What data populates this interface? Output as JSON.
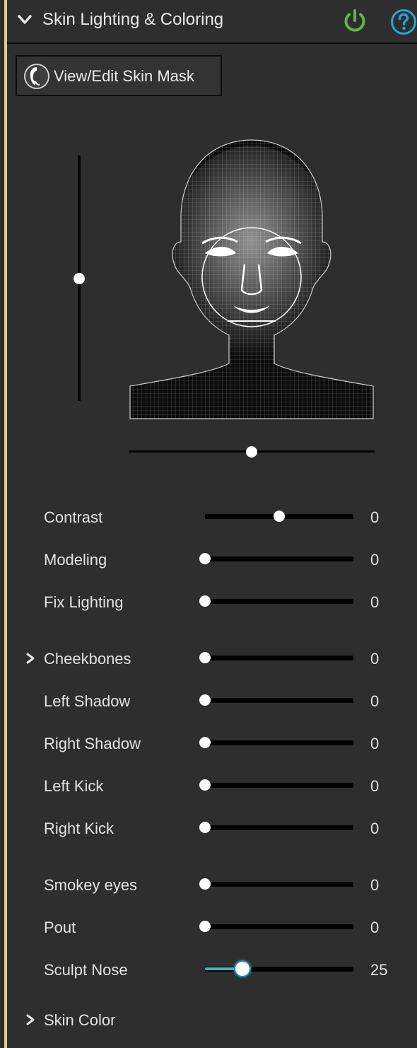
{
  "header": {
    "title": "Skin Lighting & Coloring",
    "power_color": "#5cb848",
    "help_color": "#29a3d6"
  },
  "mask_button": {
    "label": "View/Edit Skin Mask"
  },
  "light_direction": {
    "vertical_level": 0.5,
    "horizontal_level": 0.5
  },
  "sliders": [
    {
      "id": "contrast",
      "label": "Contrast",
      "value": "0",
      "level": 0.5,
      "has_chevron": false
    },
    {
      "id": "modeling",
      "label": "Modeling",
      "value": "0",
      "level": 0,
      "has_chevron": false
    },
    {
      "id": "fix-lighting",
      "label": "Fix Lighting",
      "value": "0",
      "level": 0,
      "has_chevron": false
    },
    {
      "id": "cheekbones",
      "label": "Cheekbones",
      "value": "0",
      "level": 0,
      "has_chevron": true
    },
    {
      "id": "left-shadow",
      "label": "Left Shadow",
      "value": "0",
      "level": 0,
      "has_chevron": false
    },
    {
      "id": "right-shadow",
      "label": "Right Shadow",
      "value": "0",
      "level": 0,
      "has_chevron": false
    },
    {
      "id": "left-kick",
      "label": "Left Kick",
      "value": "0",
      "level": 0,
      "has_chevron": false
    },
    {
      "id": "right-kick",
      "label": "Right Kick",
      "value": "0",
      "level": 0,
      "has_chevron": false
    },
    {
      "id": "smokey-eyes",
      "label": "Smokey eyes",
      "value": "0",
      "level": 0,
      "has_chevron": false
    },
    {
      "id": "pout",
      "label": "Pout",
      "value": "0",
      "level": 0,
      "has_chevron": false
    },
    {
      "id": "sculpt-nose",
      "label": "Sculpt Nose",
      "value": "25",
      "level": 0.25,
      "has_chevron": false,
      "active": true,
      "fill_color": "#36b6d0"
    }
  ],
  "skin_color_section": {
    "label": "Skin Color"
  }
}
